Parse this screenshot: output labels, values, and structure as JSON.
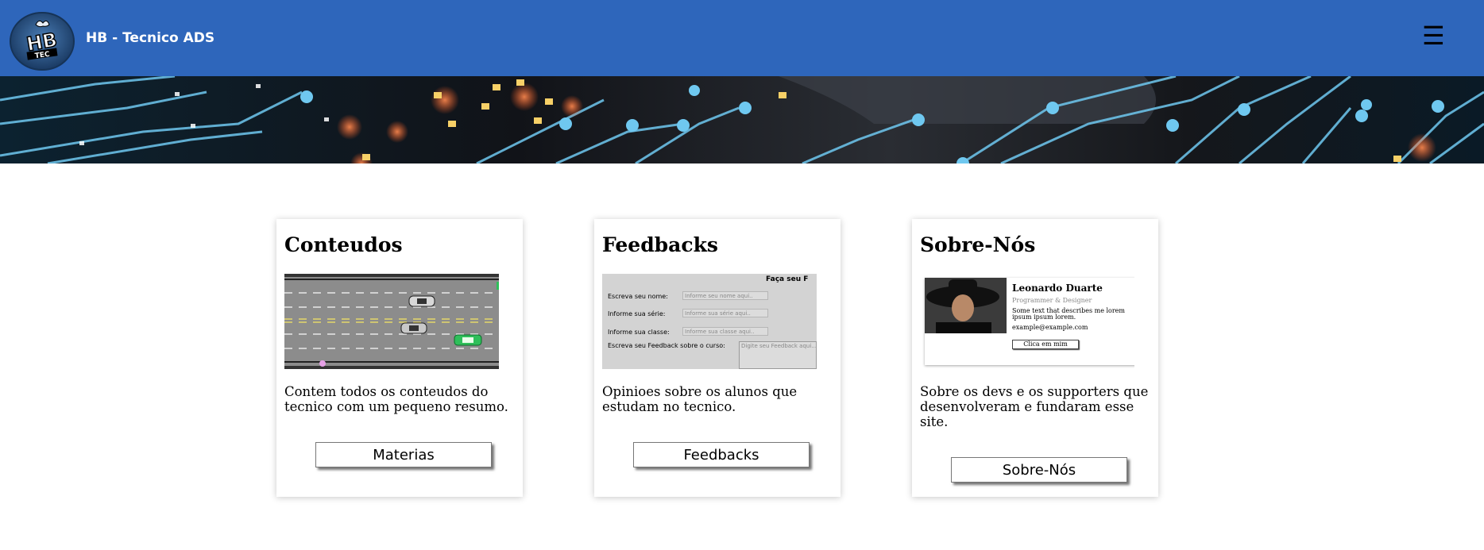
{
  "header": {
    "title": "HB - Tecnico ADS",
    "logo_text": "HB TEC",
    "menu_icon": "hamburger-icon",
    "background": "#2e66bb"
  },
  "cards": [
    {
      "title": "Conteudos",
      "description": "Contem todos os conteudos do tecnico com um pequeno resumo.",
      "button": "Materias"
    },
    {
      "title": "Feedbacks",
      "description": "Opinioes sobre os alunos que estudam no tecnico.",
      "button": "Feedbacks",
      "preview": {
        "title": "Faça seu F",
        "rows": [
          {
            "label": "Escreva seu nome:",
            "placeholder": "Informe seu nome aqui.."
          },
          {
            "label": "Informe sua série:",
            "placeholder": "Informe sua série aqui.."
          },
          {
            "label": "Informe sua classe:",
            "placeholder": "Informe sua classe aqui.."
          },
          {
            "label": "Escreva seu Feedback sobre o curso:",
            "placeholder": "Digite seu Feedback aqui..."
          }
        ]
      }
    },
    {
      "title": "Sobre-Nós",
      "description": "Sobre os devs e os supporters que desenvolveram e fundaram esse site.",
      "button": "Sobre-Nós",
      "preview": {
        "name": "Leonardo Duarte",
        "role": "Programmer & Designer",
        "text": "Some text that describes me lorem ipsum ipsum lorem.",
        "email": "example@example.com",
        "button": "Clica em mim"
      }
    }
  ]
}
